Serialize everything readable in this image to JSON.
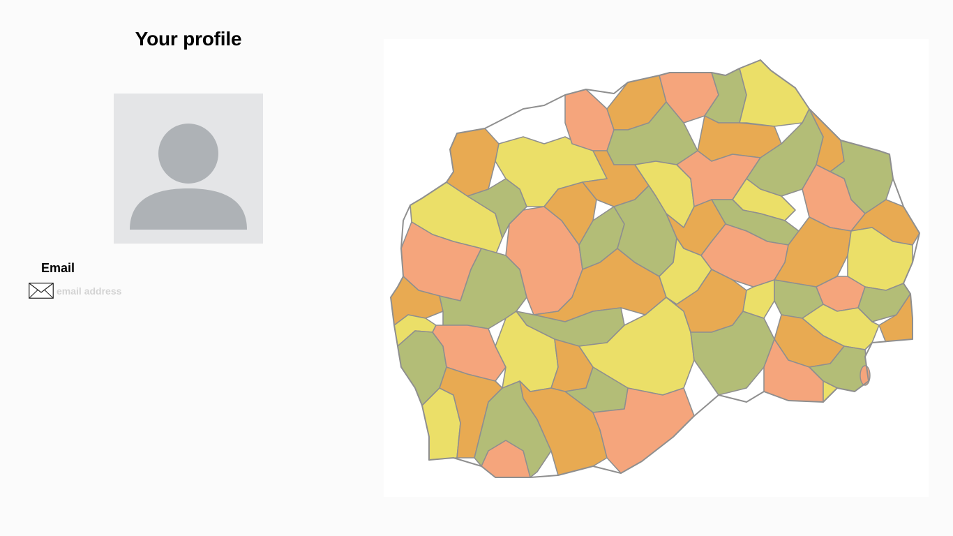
{
  "profile": {
    "title": "Your profile",
    "avatar_icon": "user-silhouette-icon",
    "email_label": "Email",
    "email_icon": "envelope-icon",
    "email_placeholder": "email address",
    "email_value": ""
  },
  "map": {
    "palette": {
      "salmon": "#f5a57c",
      "orange": "#e8aa52",
      "olive": "#b3bd77",
      "yellow": "#ebdf68",
      "background": "#ffffff",
      "border": "#8f8f8f"
    }
  }
}
